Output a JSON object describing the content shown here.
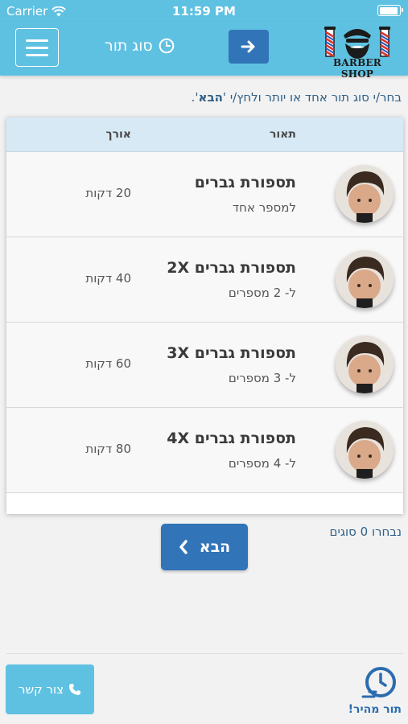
{
  "status_bar": {
    "carrier": "Carrier",
    "time": "11:59 PM"
  },
  "header": {
    "title": "סוג תור",
    "logo_text": "BARBER SHOP"
  },
  "instruction": {
    "prefix": "בחר/י סוג תור אחד או יותר ולחץ/י '",
    "emphasis": "הבא",
    "suffix": "'."
  },
  "table": {
    "columns": {
      "description": "תאור",
      "length": "אורך"
    },
    "rows": [
      {
        "title": "תספורת גברים",
        "subtitle": "למספר אחד",
        "length": "20 דקות"
      },
      {
        "title": "תספורת גברים 2X",
        "subtitle": "ל- 2 מספרים",
        "length": "40 דקות"
      },
      {
        "title": "תספורת גברים 3X",
        "subtitle": "ל- 3 מספרים",
        "length": "60 דקות"
      },
      {
        "title": "תספורת גברים 4X",
        "subtitle": "ל- 4 מספרים",
        "length": "80 דקות"
      }
    ]
  },
  "selected_count": "נבחרו 0 סוגים",
  "next_button": "הבא",
  "footer": {
    "contact_label": "צור קשר",
    "quick_label": "תור מהיר!"
  },
  "colors": {
    "header": "#5fc1e1",
    "primary_button": "#3174b8",
    "table_header": "#d7e9f4"
  },
  "icons": [
    "wifi-icon",
    "battery-icon",
    "hamburger-menu-icon",
    "clock-icon",
    "arrow-right-icon",
    "chevron-left-icon",
    "phone-icon",
    "quick-clock-icon"
  ]
}
